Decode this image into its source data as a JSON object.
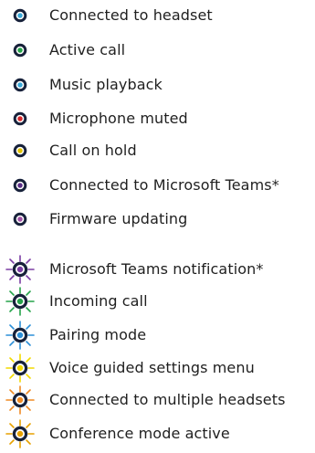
{
  "legend": {
    "items": [
      {
        "label": "Connected to headset",
        "icon": "steady-light-icon",
        "color": "#3aa8d8",
        "style": "steady"
      },
      {
        "label": "Active call",
        "icon": "steady-light-icon",
        "color": "#25a34a",
        "style": "steady"
      },
      {
        "label": "Music playback",
        "icon": "steady-light-icon",
        "color": "#3aa8d8",
        "style": "steady"
      },
      {
        "label": "Microphone muted",
        "icon": "steady-light-icon",
        "color": "#d6282b",
        "style": "steady"
      },
      {
        "label": "Call on hold",
        "icon": "steady-light-icon",
        "color": "#e0c100",
        "style": "steady"
      },
      {
        "label": "Connected to Microsoft Teams*",
        "icon": "steady-light-icon",
        "color": "#5a2d86",
        "style": "steady"
      },
      {
        "label": "Firmware updating",
        "icon": "steady-light-icon",
        "color": "#9f4fa4",
        "style": "steady"
      },
      {
        "label": "Microsoft Teams notification*",
        "icon": "flashing-light-icon",
        "color": "#7b3da4",
        "style": "flashing"
      },
      {
        "label": "Incoming call",
        "icon": "flashing-light-icon",
        "color": "#25a34a",
        "style": "flashing"
      },
      {
        "label": "Pairing mode",
        "icon": "flashing-light-icon",
        "color": "#2c8fd8",
        "style": "flashing"
      },
      {
        "label": "Voice guided settings menu",
        "icon": "flashing-light-icon",
        "color": "#f2da00",
        "style": "flashing"
      },
      {
        "label": "Connected to multiple headsets",
        "icon": "flashing-light-icon",
        "color": "#f08a24",
        "style": "flashing"
      },
      {
        "label": "Conference mode active",
        "icon": "flashing-light-icon",
        "color": "#e7a100",
        "style": "flashing"
      }
    ]
  }
}
